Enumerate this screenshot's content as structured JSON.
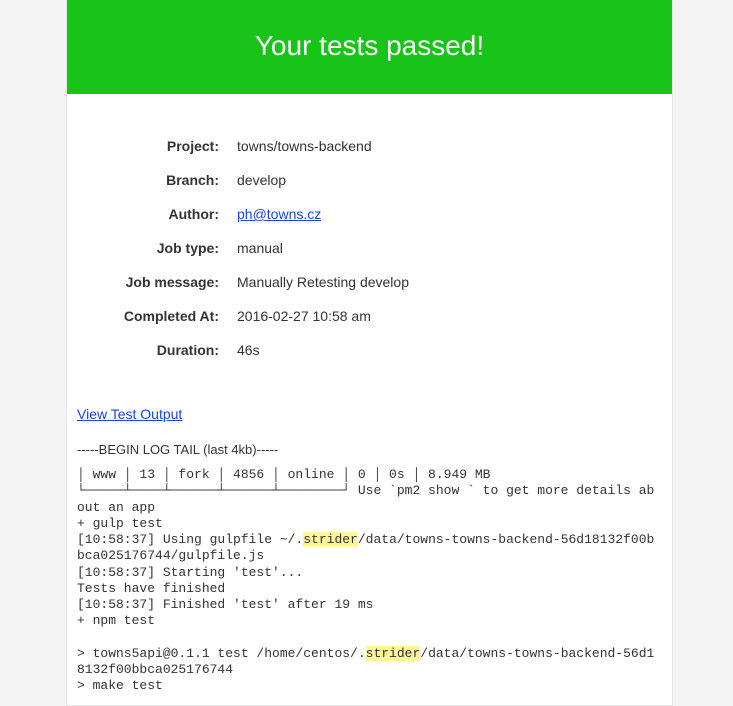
{
  "banner": {
    "title": "Your tests passed!"
  },
  "meta": {
    "labels": {
      "project": "Project:",
      "branch": "Branch:",
      "author": "Author:",
      "jobType": "Job type:",
      "jobMessage": "Job message:",
      "completedAt": "Completed At:",
      "duration": "Duration:"
    },
    "values": {
      "project": "towns/towns-backend",
      "branch": "develop",
      "author": "ph@towns.cz",
      "jobType": "manual",
      "jobMessage": "Manually Retesting develop",
      "completedAt": "2016-02-27 10:58 am",
      "duration": "46s"
    }
  },
  "links": {
    "viewOutput": "View Test Output"
  },
  "log": {
    "heading": "-----BEGIN LOG TAIL (last 4kb)-----",
    "topRow": "│ www │ 13 │ fork │ 4856 │ online │ 0 │ 0s │ 8.949 MB",
    "line_sep_tip": "└─────┴────┴──────┴──────┴────────┘ Use `pm2 show ` to get more details about an app",
    "line_gulp": "+ gulp test",
    "line_using_pre": "[10:58:37] Using gulpfile ~/.",
    "hl1": "strider",
    "line_using_post": "/data/towns-towns-backend-56d18132f00bbca025176744/gulpfile.js",
    "line_start": "[10:58:37] Starting 'test'...",
    "line_finished_msg": "Tests have finished",
    "line_finished": "[10:58:37] Finished 'test' after 19 ms",
    "line_npm": "+ npm test",
    "blank": "",
    "line_api_pre": "> towns5api@0.1.1 test /home/centos/.",
    "hl2": "strider",
    "line_api_post": "/data/towns-towns-backend-56d18132f00bbca025176744",
    "line_make": "> make test"
  }
}
